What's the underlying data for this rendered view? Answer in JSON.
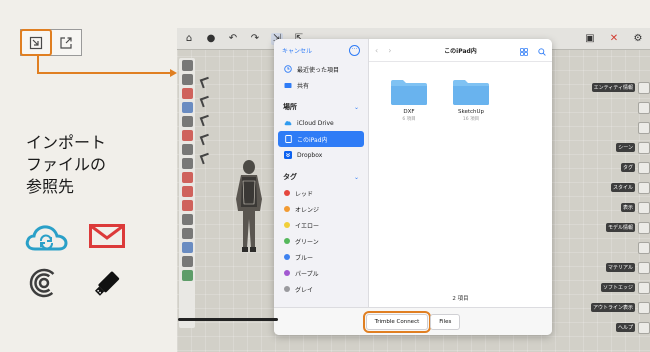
{
  "caption": {
    "line1": "インポート",
    "line2": "ファイルの",
    "line3": "参照先"
  },
  "left_icons": [
    "import-icon",
    "export-icon"
  ],
  "services": [
    "icloud-icon",
    "mail-icon",
    "airdrop-icon",
    "usb-drive-icon"
  ],
  "dialog": {
    "cancel": "キャンセル",
    "recents": "最近使った項目",
    "shared": "共有",
    "places_header": "場所",
    "places": [
      {
        "label": "iCloud Drive",
        "icon": "icloud-icon"
      },
      {
        "label": "このiPad内",
        "icon": "ipad-icon"
      },
      {
        "label": "Dropbox",
        "icon": "dropbox-icon"
      }
    ],
    "tags_header": "タグ",
    "tags": [
      {
        "label": "レッド",
        "color": "#e5473e"
      },
      {
        "label": "オレンジ",
        "color": "#f29b33"
      },
      {
        "label": "イエロー",
        "color": "#f1cf3a"
      },
      {
        "label": "グリーン",
        "color": "#55b85c"
      },
      {
        "label": "ブルー",
        "color": "#3e82f0"
      },
      {
        "label": "パープル",
        "color": "#a259d1"
      },
      {
        "label": "グレイ",
        "color": "#9a9a9e"
      }
    ],
    "title": "このiPad内",
    "folders": [
      {
        "name": "DXF",
        "count": "6 項目"
      },
      {
        "name": "SketchUp",
        "count": "16 項目"
      }
    ],
    "item_count": "2 項目",
    "tabs": [
      "Trimble Connect",
      "Files"
    ]
  },
  "right_panel": [
    "エンティティ情報",
    "",
    "",
    "シーン",
    "タグ",
    "スタイル",
    "表示",
    "モデル情報",
    "",
    "マテリアル",
    "ソフトエッジ",
    "アウトライン表示",
    "ヘルプ"
  ],
  "colors": {
    "accent": "#e07f22",
    "ios_blue": "#2f7cf6",
    "folder": "#7fc2f3"
  }
}
